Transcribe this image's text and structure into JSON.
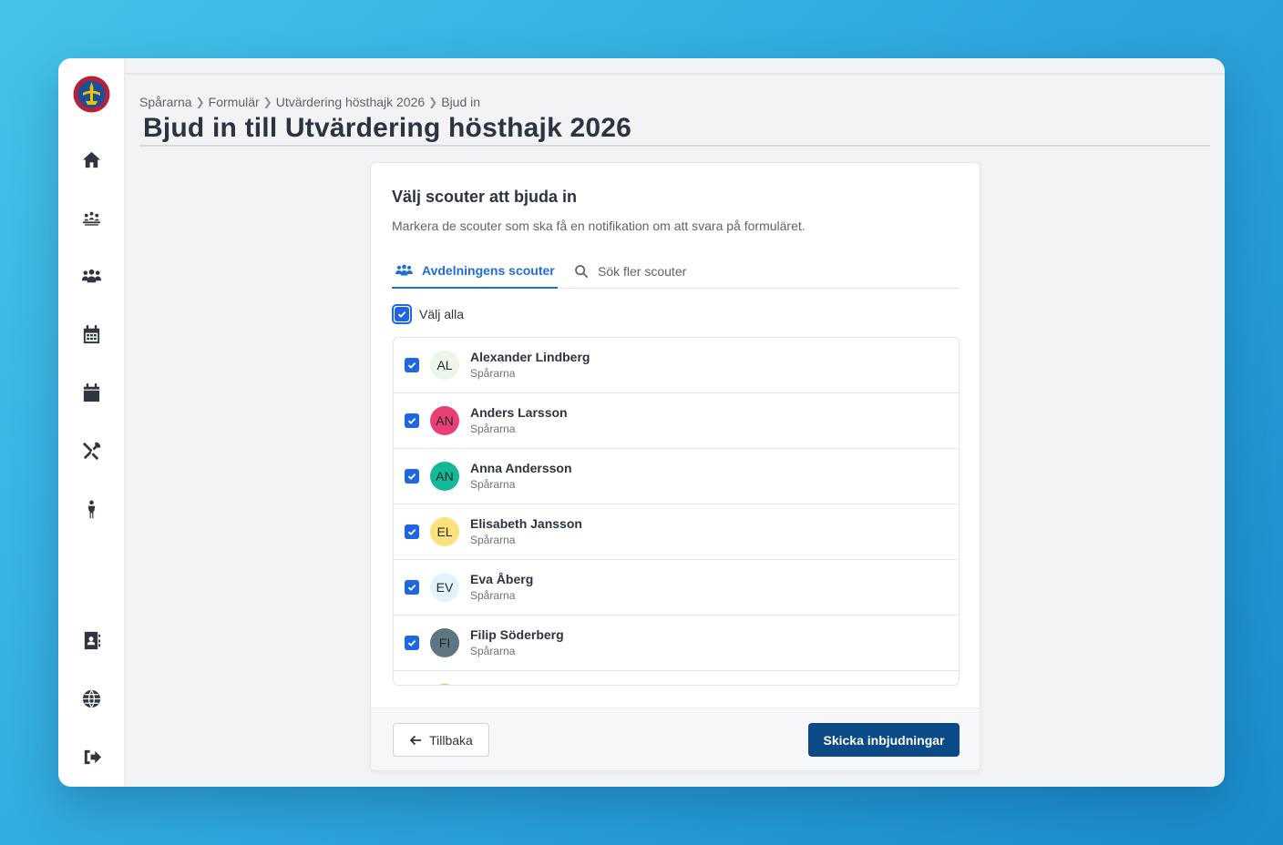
{
  "breadcrumb": [
    "Spårarna",
    "Formulär",
    "Utvärdering hösthajk 2026",
    "Bjud in"
  ],
  "page_title": "Bjud in till Utvärdering hösthajk 2026",
  "card": {
    "title": "Välj scouter att bjuda in",
    "description": "Markera de scouter som ska få en notifikation om att svara på formuläret."
  },
  "tabs": [
    {
      "label": "Avdelningens scouter",
      "icon": "users-icon",
      "active": true
    },
    {
      "label": "Sök fler scouter",
      "icon": "search-icon",
      "active": false
    }
  ],
  "select_all": {
    "label": "Välj alla",
    "checked": true
  },
  "scouts": [
    {
      "initials": "AL",
      "name": "Alexander Lindberg",
      "group": "Spårarna",
      "checked": true,
      "avatar_color": "#eef5e9"
    },
    {
      "initials": "AN",
      "name": "Anders Larsson",
      "group": "Spårarna",
      "checked": true,
      "avatar_color": "#ea3f74"
    },
    {
      "initials": "AN",
      "name": "Anna Andersson",
      "group": "Spårarna",
      "checked": true,
      "avatar_color": "#14b896"
    },
    {
      "initials": "EL",
      "name": "Elisabeth Jansson",
      "group": "Spårarna",
      "checked": true,
      "avatar_color": "#fbe27a"
    },
    {
      "initials": "EV",
      "name": "Eva Åberg",
      "group": "Spårarna",
      "checked": true,
      "avatar_color": "#e3f3fb"
    },
    {
      "initials": "FI",
      "name": "Filip Söderberg",
      "group": "Spårarna",
      "checked": true,
      "avatar_color": "#5f7680"
    }
  ],
  "footer": {
    "back_label": "Tillbaka",
    "submit_label": "Skicka inbjudningar"
  },
  "colors": {
    "accent": "#1f6fd6",
    "primary_button": "#0b4a86",
    "checkbox": "#1f66e0"
  },
  "sidebar_icons": [
    "home-icon",
    "campfire-group-icon",
    "people-icon",
    "calendar-grid-icon",
    "calendar-icon",
    "tools-icon",
    "scout-person-icon",
    "contact-card-icon",
    "globe-icon",
    "logout-icon"
  ]
}
